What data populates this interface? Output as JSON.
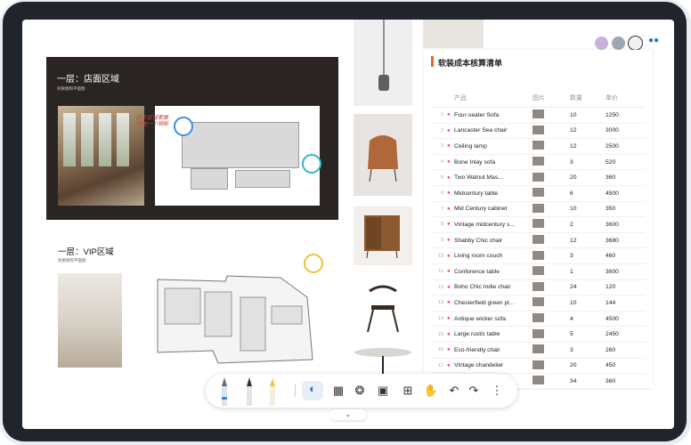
{
  "board1": {
    "title": "一层：店面区域",
    "subtitle": "效果图和平面图"
  },
  "board2": {
    "title": "一层：VIP区域",
    "subtitle": "效果图和平面图"
  },
  "annotation": {
    "text": "这个区域需要增加一个隔断"
  },
  "panel": {
    "title": "软装成本核算清单",
    "columns": [
      "产品",
      "图片",
      "数量",
      "单价"
    ],
    "rows": [
      {
        "idx": "1",
        "name": "Four-seater Sofa",
        "qty": "10",
        "price": "1250"
      },
      {
        "idx": "2",
        "name": "Lancaster Sea chair",
        "qty": "12",
        "price": "3000"
      },
      {
        "idx": "3",
        "name": "Ceiling lamp",
        "qty": "12",
        "price": "2500"
      },
      {
        "idx": "4",
        "name": "Bone Inlay sofa",
        "qty": "3",
        "price": "520"
      },
      {
        "idx": "5",
        "name": "Two Walnut Mas...",
        "qty": "20",
        "price": "360"
      },
      {
        "idx": "6",
        "name": "Midcentury table",
        "qty": "6",
        "price": "4500"
      },
      {
        "idx": "7",
        "name": "Mid Century cabinet",
        "qty": "10",
        "price": "350"
      },
      {
        "idx": "8",
        "name": "Vintage midcentury s...",
        "qty": "2",
        "price": "3600"
      },
      {
        "idx": "9",
        "name": "Shabby Chic chair",
        "qty": "12",
        "price": "3680"
      },
      {
        "idx": "10",
        "name": "Living room couch",
        "qty": "3",
        "price": "460"
      },
      {
        "idx": "11",
        "name": "Conference table",
        "qty": "1",
        "price": "3600"
      },
      {
        "idx": "12",
        "name": "Boho Chic Indie chair",
        "qty": "24",
        "price": "120"
      },
      {
        "idx": "13",
        "name": "Chesterfield green pl...",
        "qty": "10",
        "price": "144"
      },
      {
        "idx": "14",
        "name": "Antique wicker sofa",
        "qty": "4",
        "price": "4500"
      },
      {
        "idx": "15",
        "name": "Large rustic table",
        "qty": "5",
        "price": "2450"
      },
      {
        "idx": "16",
        "name": "Eco-friendly chair",
        "qty": "3",
        "price": "260"
      },
      {
        "idx": "17",
        "name": "Vintage chandelier",
        "qty": "20",
        "price": "450"
      },
      {
        "idx": "18",
        "name": "Medieval throw pillow",
        "qty": "34",
        "price": "360"
      }
    ]
  },
  "toolbar": {
    "tools": [
      "pen-tool",
      "pencil-tool",
      "highlighter-tool",
      "palette-icon",
      "keyboard-icon",
      "lasso-icon",
      "scan-icon",
      "add-icon",
      "hand-icon",
      "undo-icon",
      "redo-icon",
      "more-icon"
    ]
  },
  "colors": {
    "accent": "#e8652d",
    "pin": "#3a8ee6",
    "board_bg": "#2a2522"
  }
}
